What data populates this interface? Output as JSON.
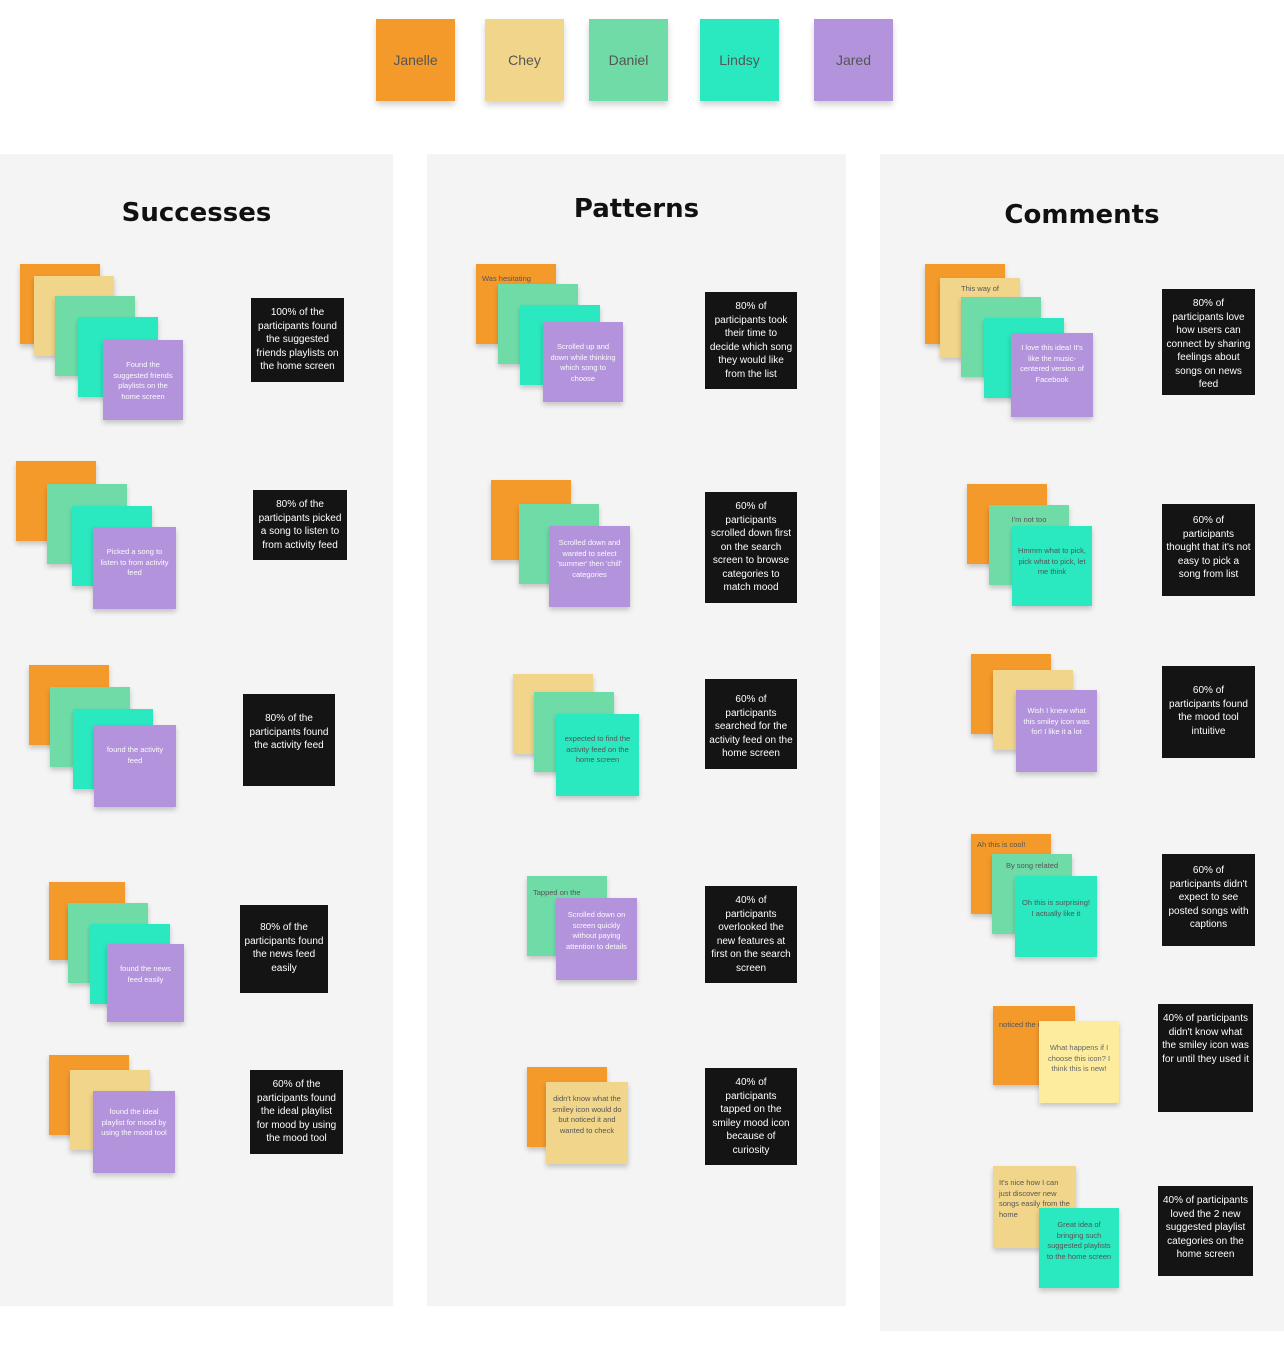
{
  "legend": [
    {
      "name": "Janelle",
      "color": "#f49a2b"
    },
    {
      "name": "Chey",
      "color": "#f0d58a"
    },
    {
      "name": "Daniel",
      "color": "#6fdca8"
    },
    {
      "name": "Lindsy",
      "color": "#2ae8bf"
    },
    {
      "name": "Jared",
      "color": "#b394dc"
    }
  ],
  "columns": {
    "successes": {
      "title": "Successes",
      "groups": [
        {
          "top_note": "Found the suggested friends playlists on the home screen",
          "summary": "100% of the participants found the suggested friends playlists on the home screen"
        },
        {
          "top_note": "Picked a song to listen to from activity feed",
          "summary": "80% of the participants picked a song to listen to from activity feed"
        },
        {
          "top_note": "found the activity feed",
          "summary": "80% of the participants found the activity feed"
        },
        {
          "top_note": "found the news feed easily",
          "summary": "80% of the participants found the news feed easily"
        },
        {
          "top_note": "found the ideal playlist for mood by using the mood tool",
          "summary": "60% of the participants found the ideal playlist for mood by using the mood tool"
        }
      ]
    },
    "patterns": {
      "title": "Patterns",
      "groups": [
        {
          "back_note": "Was hesitating",
          "top_note": "Scrolled up and down while thinking which song to choose",
          "summary": "80% of participants took their time to decide which song they would like from the list"
        },
        {
          "top_note": "Scrolled down and wanted to select 'summer' then 'chill' categories",
          "summary": "60% of participants scrolled down first on the search screen to browse categories to match mood"
        },
        {
          "top_note": "expected to find the activity feed on the home screen",
          "summary": "60% of participants searched for the activity feed on the home screen"
        },
        {
          "back_note": "Tapped on the",
          "top_note": "Scrolled down on screen quickly without paying attention to details",
          "summary": "40% of participants overlooked the new features at first on the search screen"
        },
        {
          "top_note": "didn't know what the smiley icon would do but noticed it and wanted to check",
          "summary": "40% of participants tapped on the smiley mood icon because of curiosity"
        }
      ]
    },
    "comments": {
      "title": "Comments",
      "groups": [
        {
          "back_note": "This way of",
          "top_note": "I love this idea! It's like the music-centered version of Facebook",
          "summary": "80% of participants love how users can connect by sharing feelings about songs on news feed"
        },
        {
          "back_note": "I'm not too",
          "top_note": "Hmmm what to pick, pick what to pick, let me think",
          "summary": "60% of participants thought that it's not easy to pick a song from list"
        },
        {
          "top_note": "Wish I knew what this smiley icon was for! I like it a lot",
          "summary": "60% of participants found the mood tool intuitive"
        },
        {
          "back_note": "Ah this is cool!",
          "middle_note": "By song related",
          "top_note": "Oh this is surprising! I actually like it",
          "summary": "60% of participants didn't expect to see posted songs with captions"
        },
        {
          "back_note": "noticed the icon and",
          "top_note": "What happens if I choose this icon? I think this is new!",
          "summary": "40% of participants didn't know what the smiley icon was for until they used it"
        },
        {
          "back_note": "It's nice how I can just discover new songs easily from the home",
          "top_note": "Great idea of bringing such suggested playlists to the home screen",
          "summary": "40% of participants loved the 2 new suggested playlist categories on the home screen"
        }
      ]
    }
  }
}
